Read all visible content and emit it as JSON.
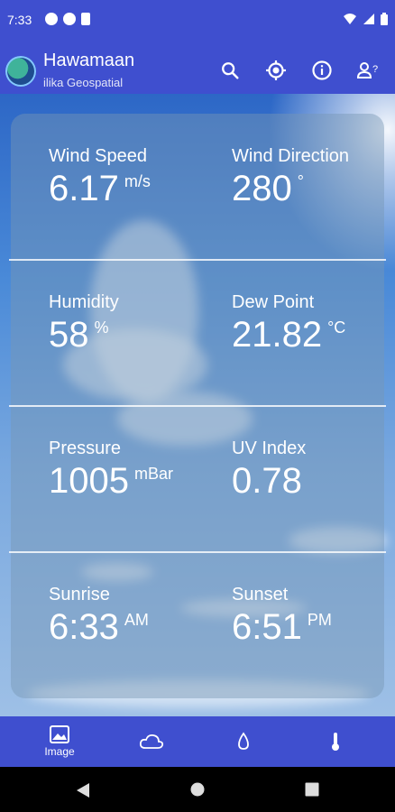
{
  "status": {
    "time": "7:33"
  },
  "app": {
    "title": "Hawamaan",
    "subtitle": "ilika Geospatial"
  },
  "actions": [
    "search-icon",
    "my-location-icon",
    "info-icon",
    "person-help-icon"
  ],
  "metrics": [
    {
      "left": {
        "label": "Wind Speed",
        "value": "6.17",
        "unit": "m/s"
      },
      "right": {
        "label": "Wind Direction",
        "value": "280",
        "unit": "°"
      }
    },
    {
      "left": {
        "label": "Humidity",
        "value": "58",
        "unit": "%"
      },
      "right": {
        "label": "Dew Point",
        "value": "21.82",
        "unit": "°C"
      }
    },
    {
      "left": {
        "label": "Pressure",
        "value": "1005",
        "unit": "mBar"
      },
      "right": {
        "label": "UV Index",
        "value": "0.78",
        "unit": ""
      }
    },
    {
      "left": {
        "label": "Sunrise",
        "value": "6:33",
        "unit": "AM"
      },
      "right": {
        "label": "Sunset",
        "value": "6:51",
        "unit": "PM"
      }
    }
  ],
  "bottom_nav": [
    {
      "label": "Image",
      "icon": "image-icon",
      "active": true
    },
    {
      "label": "",
      "icon": "cloud-icon",
      "active": false
    },
    {
      "label": "",
      "icon": "drop-icon",
      "active": false
    },
    {
      "label": "",
      "icon": "thermometer-icon",
      "active": false
    }
  ],
  "colors": {
    "primary": "#3f4fcf",
    "text": "#ffffff"
  }
}
